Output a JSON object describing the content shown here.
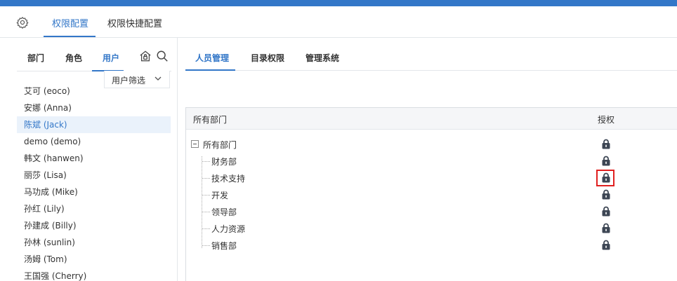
{
  "header": {
    "tabs": [
      {
        "label": "权限配置"
      },
      {
        "label": "权限快捷配置"
      }
    ]
  },
  "left": {
    "tabs": [
      {
        "label": "部门"
      },
      {
        "label": "角色"
      },
      {
        "label": "用户"
      }
    ],
    "filter_label": "用户筛选",
    "users": [
      {
        "label": "艾可 (eoco)"
      },
      {
        "label": "安娜 (Anna)"
      },
      {
        "label": "陈斌 (Jack)"
      },
      {
        "label": "demo (demo)"
      },
      {
        "label": "韩文 (hanwen)"
      },
      {
        "label": "丽莎 (Lisa)"
      },
      {
        "label": "马功成 (Mike)"
      },
      {
        "label": "孙红 (Lily)"
      },
      {
        "label": "孙建成 (Billy)"
      },
      {
        "label": "孙林 (sunlin)"
      },
      {
        "label": "汤姆 (Tom)"
      },
      {
        "label": "王国强 (Cherry)"
      }
    ]
  },
  "right": {
    "tabs": [
      {
        "label": "人员管理"
      },
      {
        "label": "目录权限"
      },
      {
        "label": "管理系统"
      }
    ],
    "panel": {
      "col_dept": "所有部门",
      "col_auth": "授权",
      "root": "所有部门",
      "departments": [
        {
          "label": "财务部"
        },
        {
          "label": "技术支持"
        },
        {
          "label": "开发"
        },
        {
          "label": "领导部"
        },
        {
          "label": "人力资源"
        },
        {
          "label": "销售部"
        }
      ]
    }
  },
  "colors": {
    "accent": "#3377c8",
    "highlight_box": "#e02020",
    "lock": "#3d4654"
  }
}
